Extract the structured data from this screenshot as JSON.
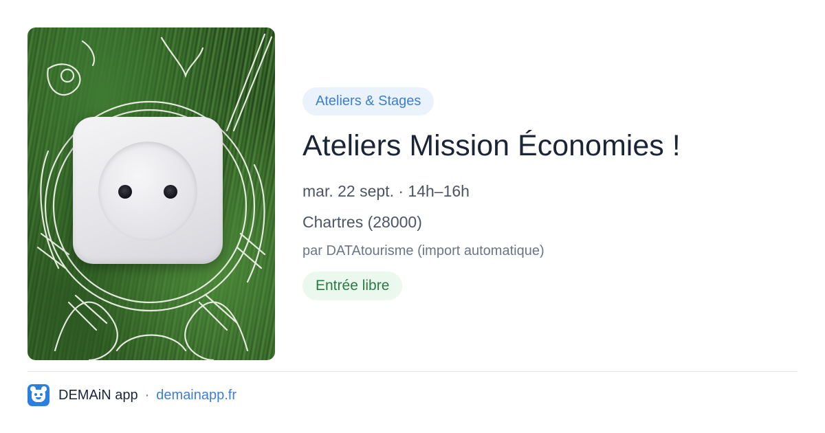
{
  "event": {
    "image": "power-socket-on-grass-with-earth-doodle",
    "category": "Ateliers & Stages",
    "title": "Ateliers Mission Économies !",
    "datetime": "mar. 22 sept. · 14h–16h",
    "location": "Chartres (28000)",
    "organizer": "par DATAtourisme (import automatique)",
    "price": "Entrée libre"
  },
  "footer": {
    "logo_icon": "demain-app-logo-icon",
    "app_name": "DEMAiN app",
    "separator": "·",
    "url": "demainapp.fr"
  },
  "colors": {
    "accent_blue": "#3b7fd4",
    "category_bg": "#eaf2fc",
    "price_green": "#2b7a42",
    "price_bg": "#eaf8ee",
    "title_text": "#1b2536"
  }
}
